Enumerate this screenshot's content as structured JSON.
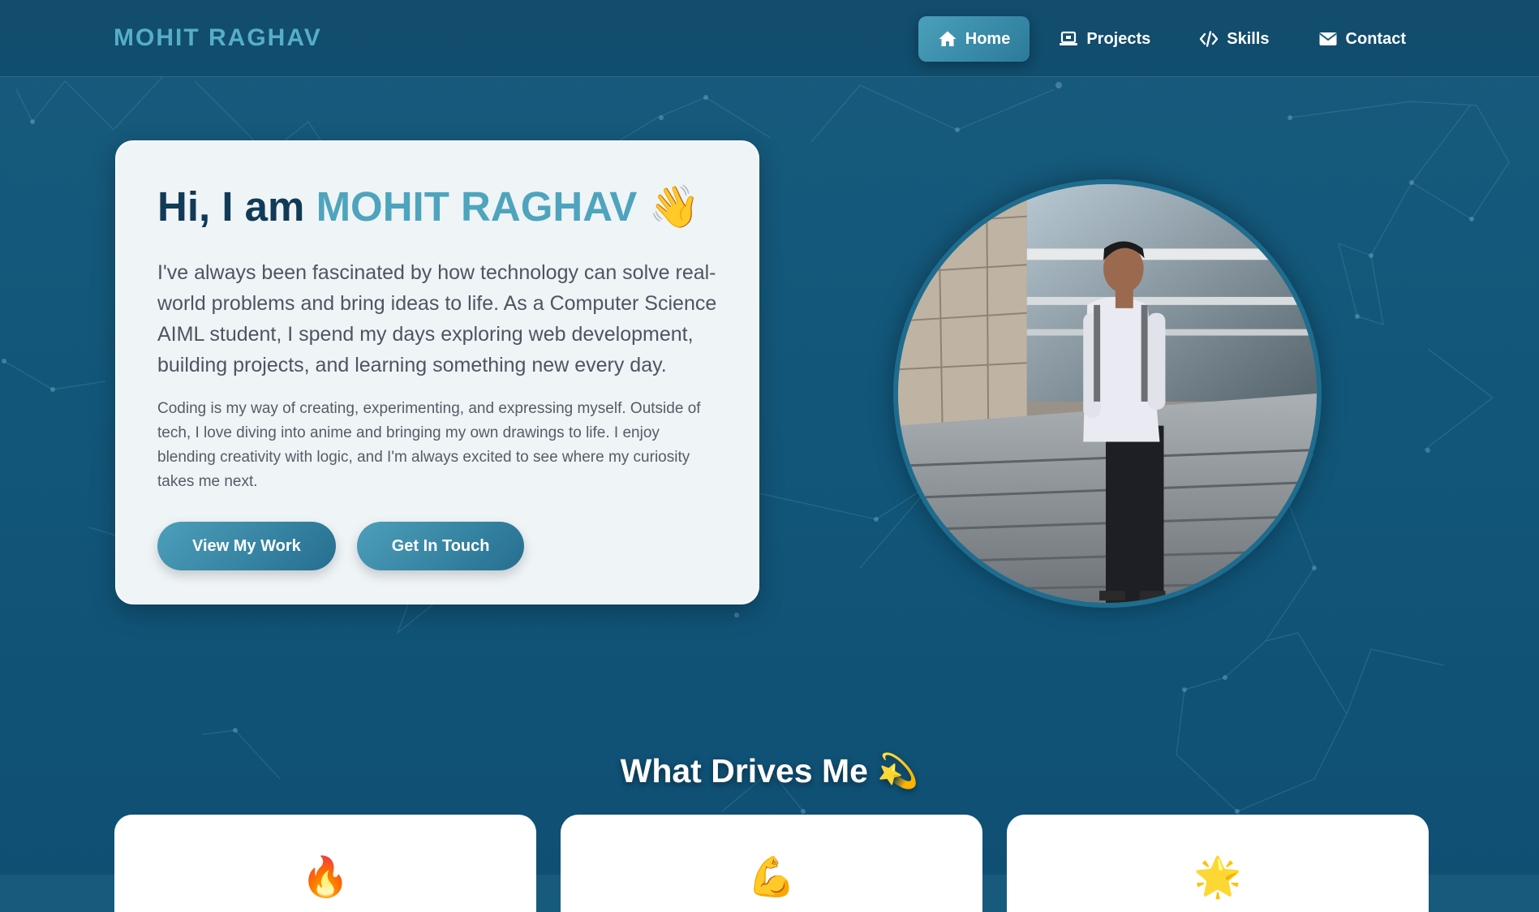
{
  "brand": "MOHIT RAGHAV",
  "nav": [
    {
      "label": "Home",
      "icon": "home-icon",
      "active": true
    },
    {
      "label": "Projects",
      "icon": "laptop-icon",
      "active": false
    },
    {
      "label": "Skills",
      "icon": "code-icon",
      "active": false
    },
    {
      "label": "Contact",
      "icon": "envelope-icon",
      "active": false
    }
  ],
  "hero": {
    "greeting": "Hi, I am",
    "name": "MOHIT RAGHAV",
    "wave": "👋",
    "lead": "I've always been fascinated by how technology can solve real-world problems and bring ideas to life. As a Computer Science AIML student, I spend my days exploring web development, building projects, and learning something new every day.",
    "text": "Coding is my way of creating, experimenting, and expressing myself. Outside of tech, I love diving into anime and bringing my own drawings to life. I enjoy blending creativity with logic, and I'm always excited to see where my curiosity takes me next.",
    "buttons": {
      "work": "View My Work",
      "touch": "Get In Touch"
    }
  },
  "drives": {
    "title": "What Drives Me 💫",
    "cards": [
      {
        "icon": "🔥",
        "icon_name": "flame-icon"
      },
      {
        "icon": "💪",
        "icon_name": "flexed-arm-icon"
      },
      {
        "icon": "🌟",
        "icon_name": "star-icon"
      }
    ]
  },
  "colors": {
    "accent": "#4ea4bd",
    "dark_navy": "#113a57",
    "background": "#12577a",
    "card": "#eff4f7"
  }
}
